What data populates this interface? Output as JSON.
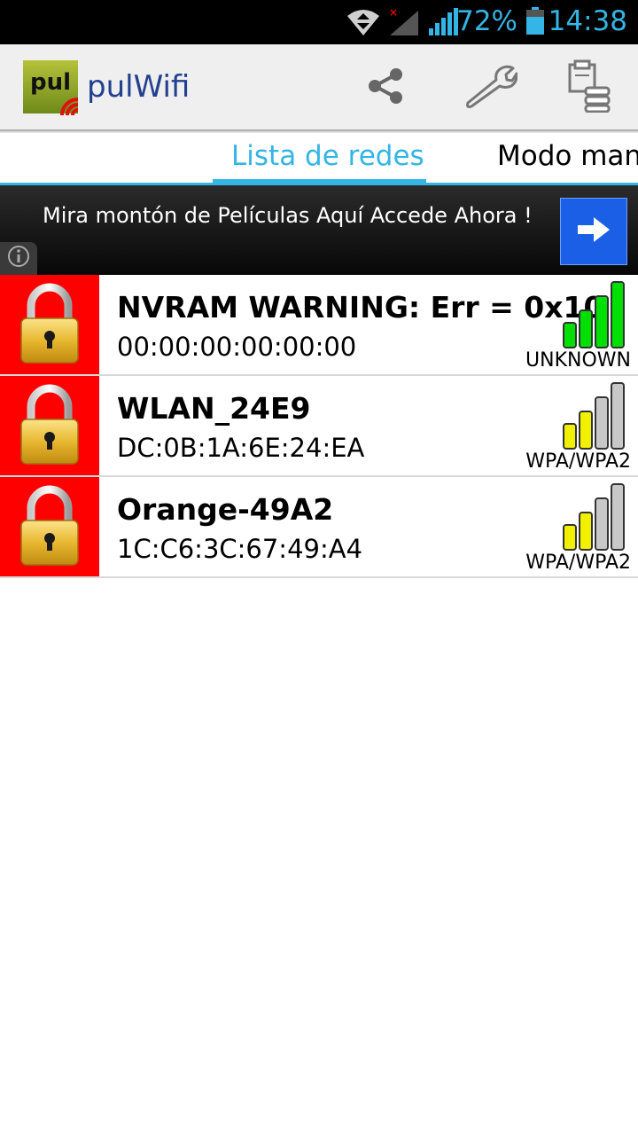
{
  "status_bar": {
    "battery_percent": "72%",
    "time": "14:38"
  },
  "app": {
    "logo_text": "pul",
    "title": "pulWifi"
  },
  "tabs": [
    {
      "label": "Lista de redes",
      "active": true
    },
    {
      "label": "Modo manual",
      "active": false
    }
  ],
  "ad": {
    "text": "Mira montón de Películas Aquí Accede Ahora !"
  },
  "networks": [
    {
      "ssid": "NVRAM WARNING: Err = 0x10",
      "mac": "00:00:00:00:00:00",
      "security": "UNKNOWN",
      "signal_bars": 4,
      "signal_color": "#00e000"
    },
    {
      "ssid": "WLAN_24E9",
      "mac": "DC:0B:1A:6E:24:EA",
      "security": "WPA/WPA2",
      "signal_bars": 2,
      "signal_color": "#f0f000"
    },
    {
      "ssid": "Orange-49A2",
      "mac": "1C:C6:3C:67:49:A4",
      "security": "WPA/WPA2",
      "signal_bars": 2,
      "signal_color": "#f0f000"
    }
  ],
  "colors": {
    "accent": "#33b5e5",
    "lock_background": "#ff0000",
    "ad_button": "#1a5fe6"
  }
}
